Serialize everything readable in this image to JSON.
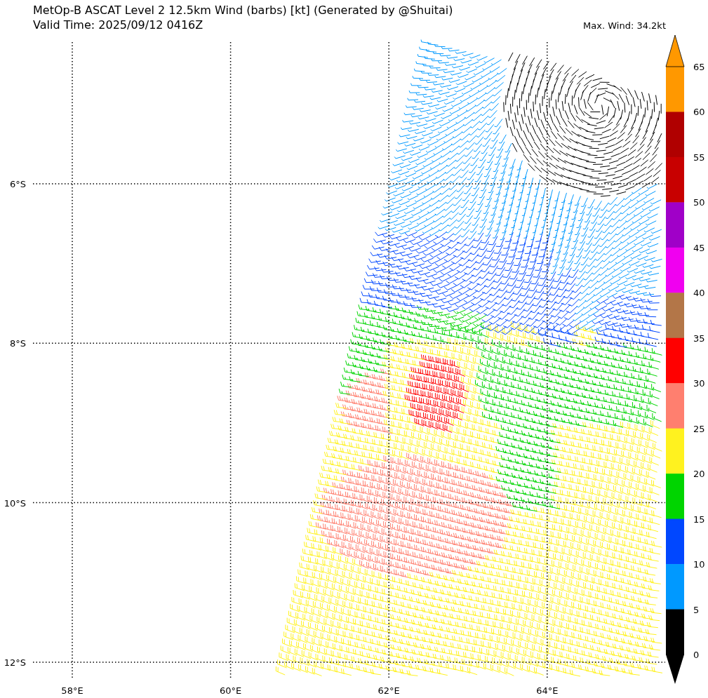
{
  "title": "MetOp-B ASCAT Level 2 12.5km Wind (barbs) [kt] (Generated by @Shuitai)",
  "subtitle": "Valid Time: 2025/09/12 0416Z",
  "max_wind": "Max. Wind: 34.2kt",
  "x_ticks": [
    "58°E",
    "60°E",
    "62°E",
    "64°E"
  ],
  "y_ticks": [
    "6°S",
    "8°S",
    "10°S",
    "12°S"
  ],
  "colorbar": {
    "labels": [
      "65",
      "60",
      "55",
      "50",
      "45",
      "40",
      "35",
      "30",
      "25",
      "20",
      "15",
      "10",
      "5",
      "0"
    ],
    "bins": [
      {
        "color": "#ff9800"
      },
      {
        "color": "#b00000"
      },
      {
        "color": "#c80000"
      },
      {
        "color": "#a000c8"
      },
      {
        "color": "#f000f0"
      },
      {
        "color": "#b37648"
      },
      {
        "color": "#ff0000"
      },
      {
        "color": "#ff7f6f"
      },
      {
        "color": "#fff21f"
      },
      {
        "color": "#00d500"
      },
      {
        "color": "#0047ff"
      },
      {
        "color": "#0099ff"
      },
      {
        "color": "#000000"
      }
    ],
    "extend_low": {
      "color": "#000000"
    },
    "extend_high": {
      "color": "#ff9800"
    }
  }
}
